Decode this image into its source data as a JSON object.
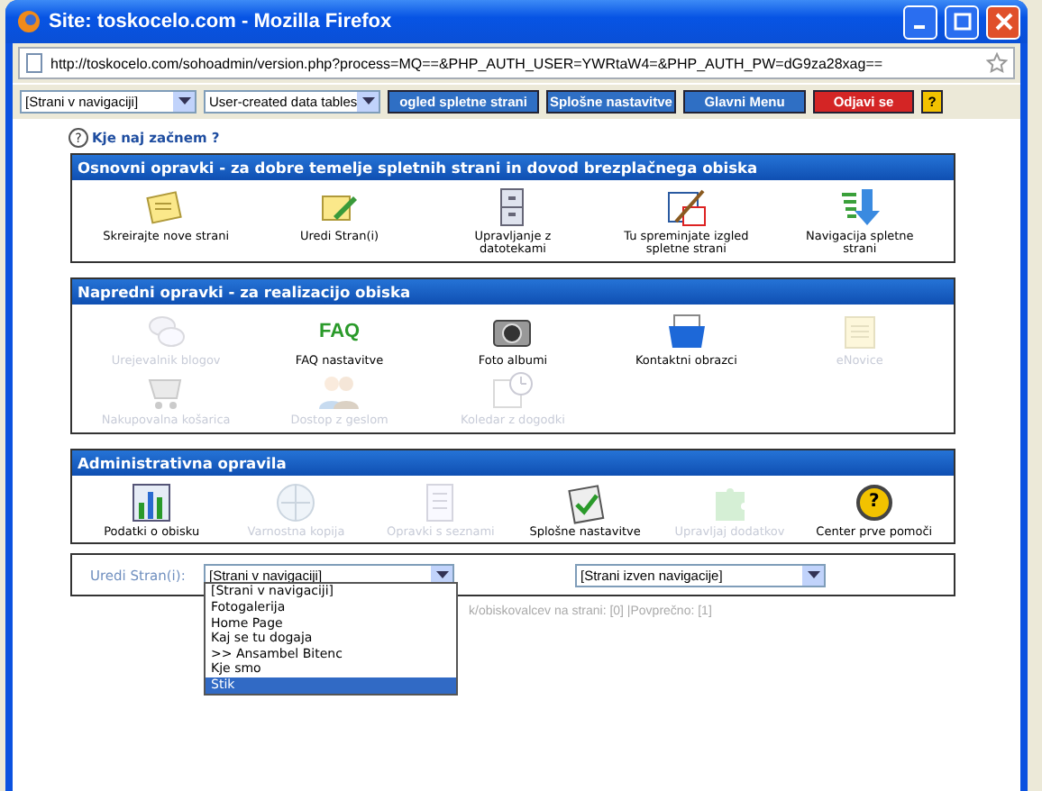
{
  "window": {
    "title": "Site: toskocelo.com - Mozilla Firefox"
  },
  "address": {
    "url": "http://toskocelo.com/sohoadmin/version.php?process=MQ==&PHP_AUTH_USER=YWRtaW4=&PHP_AUTH_PW=dG9za28xag=="
  },
  "toolbar": {
    "selects": [
      "[Strani v navigaciji]",
      "User-created data tables"
    ],
    "buttons": [
      {
        "label": "ogled spletne strani",
        "kind": "blue"
      },
      {
        "label": "Splošne nastavitve",
        "kind": "blue"
      },
      {
        "label": "Glavni Menu",
        "kind": "blue"
      },
      {
        "label": "Odjavi se",
        "kind": "red"
      },
      {
        "label": "?",
        "kind": "help"
      }
    ]
  },
  "help_link": {
    "icon_text": "?",
    "label": "Kje naj začnem ?"
  },
  "sections": [
    {
      "title": "Osnovni opravki - za dobre temelje spletnih strani in dovod brezplačnega obiska",
      "items": [
        {
          "label": "Skreirajte nove strani",
          "disabled": false
        },
        {
          "label": "Uredi Stran(i)",
          "disabled": false
        },
        {
          "label": "Upravljanje z datotekami",
          "disabled": false
        },
        {
          "label": "Tu spreminjate izgled spletne strani",
          "disabled": false
        },
        {
          "label": "Navigacija spletne strani",
          "disabled": false
        }
      ]
    },
    {
      "title": "Napredni opravki - za realizacijo obiska",
      "items": [
        {
          "label": "Urejevalnik blogov",
          "disabled": true
        },
        {
          "label": "FAQ nastavitve",
          "disabled": false,
          "icon_text": "FAQ"
        },
        {
          "label": "Foto albumi",
          "disabled": false
        },
        {
          "label": "Kontaktni obrazci",
          "disabled": false
        },
        {
          "label": "eNovice",
          "disabled": true
        },
        {
          "label": "Nakupovalna košarica",
          "disabled": true
        },
        {
          "label": "Dostop z geslom",
          "disabled": true
        },
        {
          "label": "Koledar z dogodki",
          "disabled": true
        }
      ]
    },
    {
      "title": "Administrativna opravila",
      "items": [
        {
          "label": "Podatki o obisku",
          "disabled": false
        },
        {
          "label": "Varnostna kopija",
          "disabled": true
        },
        {
          "label": "Opravki s seznami",
          "disabled": true
        },
        {
          "label": "Splošne nastavitve",
          "disabled": false
        },
        {
          "label": "Upravljaj dodatkov",
          "disabled": true
        },
        {
          "label": "Center prve pomoči",
          "disabled": false,
          "icon_text": "?"
        }
      ]
    }
  ],
  "edit_bar": {
    "label": "Uredi Stran(i):",
    "select_in": "[Strani v navigaciji]",
    "select_out": "[Strani izven navigacije]",
    "options": [
      {
        "label": "[Strani v navigaciji]",
        "selected": false
      },
      {
        "label": "Fotogalerija",
        "selected": false
      },
      {
        "label": "Home Page",
        "selected": false
      },
      {
        "label": "Kaj se tu dogaja",
        "selected": false
      },
      {
        "label": ">> Ansambel Bitenc",
        "selected": false
      },
      {
        "label": "Kje smo",
        "selected": false
      },
      {
        "label": "Stik",
        "selected": true
      }
    ]
  },
  "status_text": "k/obiskovalcev na strani: [0] |Povprečno: [1]"
}
